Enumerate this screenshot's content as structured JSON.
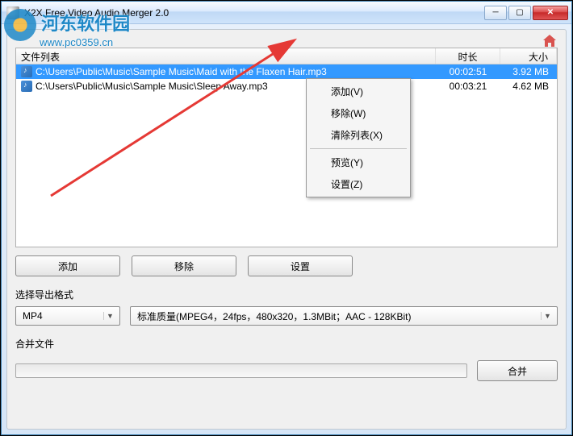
{
  "window": {
    "title": "X2X Free Video Audio Merger 2.0"
  },
  "watermark": {
    "text": "河东软件园",
    "url": "www.pc0359.cn"
  },
  "columns": {
    "file": "文件列表",
    "duration": "时长",
    "size": "大小"
  },
  "rows": [
    {
      "path": "C:\\Users\\Public\\Music\\Sample Music\\Maid with the Flaxen Hair.mp3",
      "duration": "00:02:51",
      "size": "3.92 MB",
      "selected": true
    },
    {
      "path": "C:\\Users\\Public\\Music\\Sample Music\\Sleep Away.mp3",
      "duration": "00:03:21",
      "size": "4.62 MB",
      "selected": false
    }
  ],
  "buttons": {
    "add": "添加",
    "remove": "移除",
    "settings": "设置",
    "merge": "合并"
  },
  "labels": {
    "output_format": "选择导出格式",
    "merge_file": "合并文件"
  },
  "format": {
    "selected": "MP4",
    "quality": "标准质量(MPEG4，24fps，480x320，1.3MBit；AAC - 128KBit)"
  },
  "context_menu": {
    "add": "添加(V)",
    "remove": "移除(W)",
    "clear": "清除列表(X)",
    "preview": "预览(Y)",
    "settings": "设置(Z)"
  }
}
